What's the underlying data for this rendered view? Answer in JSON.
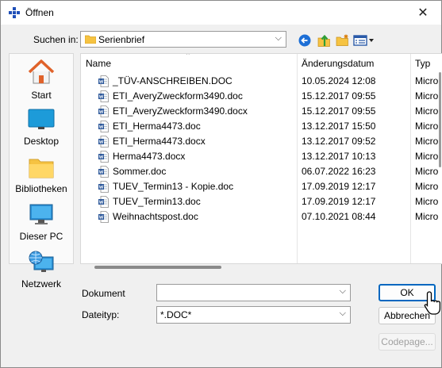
{
  "dialog": {
    "title": "Öffnen",
    "close_glyph": "✕"
  },
  "toolbar": {
    "lookin_label": "Suchen in:",
    "lookin_value": "Serienbrief",
    "back_icon": "back-arrow-icon",
    "up_icon": "up-folder-icon",
    "newfolder_icon": "new-folder-icon",
    "view_icon": "view-menu-icon"
  },
  "places": [
    {
      "label": "Start",
      "icon": "home-icon"
    },
    {
      "label": "Desktop",
      "icon": "desktop-icon"
    },
    {
      "label": "Bibliotheken",
      "icon": "libraries-icon"
    },
    {
      "label": "Dieser PC",
      "icon": "this-pc-icon"
    },
    {
      "label": "Netzwerk",
      "icon": "network-icon"
    }
  ],
  "filelist": {
    "columns": [
      "Name",
      "Änderungsdatum",
      "Typ"
    ],
    "rows": [
      {
        "name": "_TÜV-ANSCHREIBEN.DOC",
        "date": "10.05.2024 12:08",
        "type": "Micro"
      },
      {
        "name": "ETI_AveryZweckform3490.doc",
        "date": "15.12.2017 09:55",
        "type": "Micro"
      },
      {
        "name": "ETI_AveryZweckform3490.docx",
        "date": "15.12.2017 09:55",
        "type": "Micro"
      },
      {
        "name": "ETI_Herma4473.doc",
        "date": "13.12.2017 15:50",
        "type": "Micro"
      },
      {
        "name": "ETI_Herma4473.docx",
        "date": "13.12.2017 09:52",
        "type": "Micro"
      },
      {
        "name": "Herma4473.docx",
        "date": "13.12.2017 10:13",
        "type": "Micro"
      },
      {
        "name": "Sommer.doc",
        "date": "06.07.2022 16:23",
        "type": "Micro"
      },
      {
        "name": "TUEV_Termin13 - Kopie.doc",
        "date": "17.09.2019 12:17",
        "type": "Micro"
      },
      {
        "name": "TUEV_Termin13.doc",
        "date": "17.09.2019 12:17",
        "type": "Micro"
      },
      {
        "name": "Weihnachtspost.doc",
        "date": "07.10.2021 08:44",
        "type": "Micro"
      }
    ]
  },
  "form": {
    "document_label": "Dokument",
    "document_value": "",
    "filetype_label": "Dateityp:",
    "filetype_value": "*.DOC*"
  },
  "buttons": {
    "ok": "OK",
    "cancel": "Abbrechen",
    "codepage": "Codepage..."
  },
  "colors": {
    "accent": "#0067c0",
    "word_blue": "#2b579a",
    "folder_yellow": "#f6c342"
  }
}
